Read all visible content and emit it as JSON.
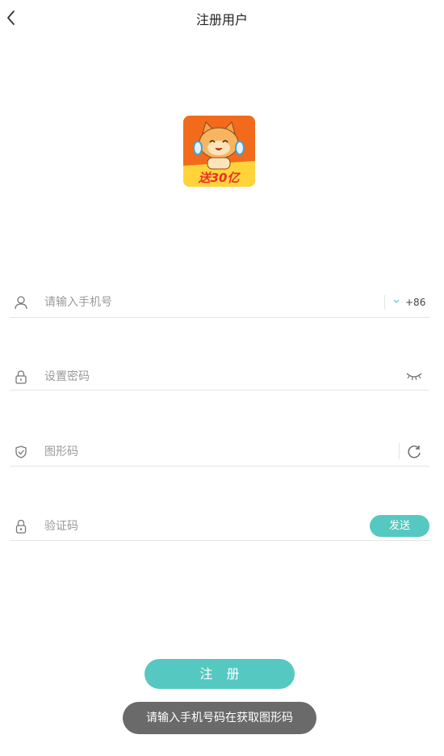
{
  "header": {
    "title": "注册用户"
  },
  "logo": {
    "badge_text": "送30亿"
  },
  "phone": {
    "placeholder": "请输入手机号",
    "country_code": "+86"
  },
  "password": {
    "placeholder": "设置密码"
  },
  "captcha": {
    "placeholder": "图形码"
  },
  "sms_code": {
    "placeholder": "验证码",
    "send_label": "发送"
  },
  "register": {
    "label": "注 册"
  },
  "toast": {
    "message": "请输入手机号码在获取图形码"
  },
  "colors": {
    "accent": "#55c8c1",
    "toast_bg": "#6a6a6a",
    "logo_orange": "#f26a1b",
    "logo_yellow": "#ffd33a"
  }
}
